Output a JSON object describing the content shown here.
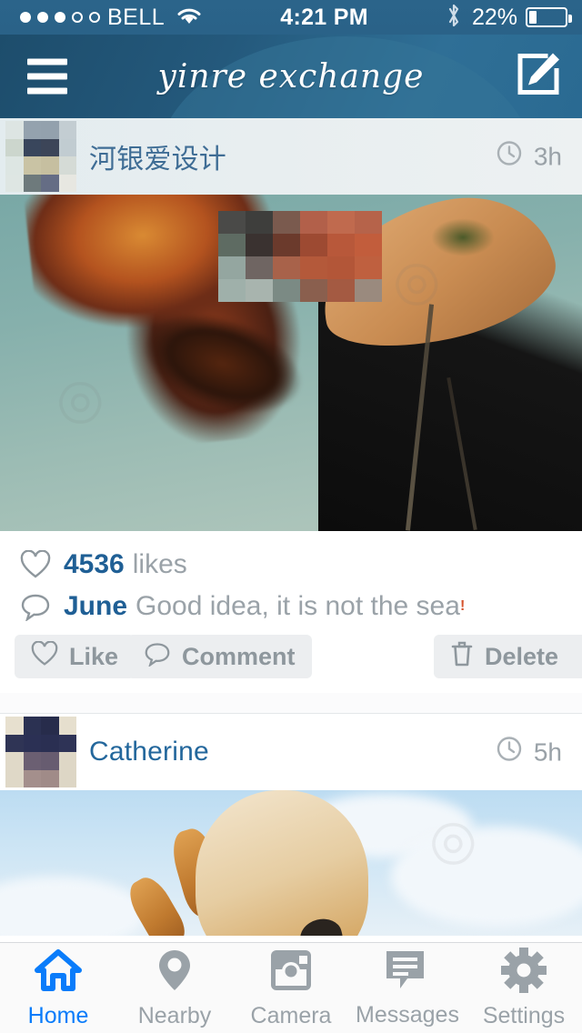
{
  "status_bar": {
    "carrier": "BELL",
    "signal_filled": 3,
    "signal_total": 5,
    "wifi_icon": "wifi-icon",
    "time": "4:21 PM",
    "bluetooth_icon": "bluetooth-icon",
    "battery_percent": "22%",
    "battery_level": 22
  },
  "nav": {
    "menu_icon": "hamburger-menu-icon",
    "title": "yinre exchange",
    "compose_icon": "compose-pencil-icon"
  },
  "colors": {
    "nav_blue_dark": "#1d4d6c",
    "nav_blue_light": "#2f6f96",
    "accent_blue": "#1f5f95",
    "tab_active": "#0a7cfa",
    "muted_gray": "#9aa2a8",
    "button_bg": "#eceef0"
  },
  "feed": {
    "posts": [
      {
        "author": "河银爱设计",
        "avatar_name": "avatar-pixelated",
        "clock_icon": "clock-icon",
        "time_ago": "3h",
        "photo_name": "post-photo-woman-sea",
        "likes_count": "4536",
        "likes_label": "likes",
        "heart_icon": "heart-outline-icon",
        "comment_icon": "comment-bubble-icon",
        "comment_author": "June",
        "comment_text": "Good idea, it is not the sea",
        "comment_punct": "!",
        "actions": [
          {
            "label": "Like",
            "icon": "heart-outline-icon"
          },
          {
            "label": "Comment",
            "icon": "comment-bubble-icon"
          },
          {
            "label": "Delete",
            "icon": "trash-icon"
          }
        ]
      },
      {
        "author": "Catherine",
        "avatar_name": "avatar-pixelated",
        "clock_icon": "clock-icon",
        "time_ago": "5h",
        "photo_name": "post-photo-giraffe-sky"
      }
    ]
  },
  "tabbar": {
    "items": [
      {
        "label": "Home",
        "icon": "home-icon",
        "active": true
      },
      {
        "label": "Nearby",
        "icon": "map-pin-icon",
        "active": false
      },
      {
        "label": "Camera",
        "icon": "camera-icon",
        "active": false
      },
      {
        "label": "Messages",
        "icon": "chat-icon",
        "active": false
      },
      {
        "label": "Settings",
        "icon": "gear-icon",
        "active": false
      }
    ]
  }
}
